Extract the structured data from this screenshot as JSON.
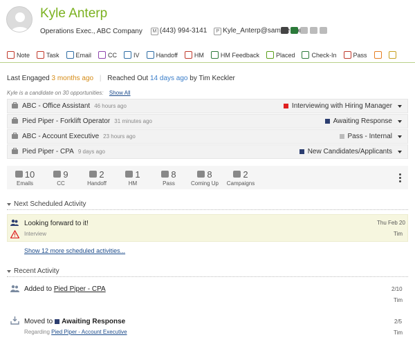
{
  "header": {
    "name": "Kyle Anterp",
    "title": "Operations Exec.",
    "company": "ABC Company",
    "phone_badge": "M",
    "phone": "(443) 994-3141",
    "email_badge": "P",
    "email": "Kyle_Anterp@sample.com",
    "social_icons": [
      "email-icon",
      "phone-icon",
      "facebook-icon",
      "linkedin-icon",
      "twitter-icon"
    ]
  },
  "toolbar": {
    "items": [
      {
        "label": "Note",
        "icon": "note-icon",
        "color": "#c0392b"
      },
      {
        "label": "Task",
        "icon": "task-icon",
        "color": "#c0392b"
      },
      {
        "label": "Email",
        "icon": "email-icon",
        "color": "#2e6da4"
      },
      {
        "label": "CC",
        "icon": "phone-icon",
        "color": "#8e44ad"
      },
      {
        "label": "IV",
        "icon": "people-icon",
        "color": "#2e6da4"
      },
      {
        "label": "Handoff",
        "icon": "check-icon",
        "color": "#2e6da4"
      },
      {
        "label": "HM",
        "icon": "people-icon",
        "color": "#c0392b"
      },
      {
        "label": "HM Feedback",
        "icon": "arrows-icon",
        "color": "#2c7a3a"
      },
      {
        "label": "Placed",
        "icon": "thumbs-up-icon",
        "color": "#5a9e1a"
      },
      {
        "label": "Check-In",
        "icon": "calendar-check-icon",
        "color": "#2c7a3a"
      },
      {
        "label": "Pass",
        "icon": "thumbs-down-icon",
        "color": "#c0392b"
      },
      {
        "label": "",
        "icon": "phone-icon",
        "color": "#e67e22"
      },
      {
        "label": "",
        "icon": "clipboard-icon",
        "color": "#c8a020"
      }
    ]
  },
  "engagement": {
    "last_engaged_label": "Last Engaged",
    "last_engaged_value": "3 months ago",
    "reached_out_label": "Reached Out",
    "reached_out_value": "14 days ago",
    "reached_out_by": "by Tim Keckler"
  },
  "candidate_note": {
    "text": "Kyle is a candidate on 30 opportunities:",
    "link": "Show All"
  },
  "opportunities": [
    {
      "title": "ABC - Office Assistant",
      "ago": "46 hours ago",
      "status": "Interviewing with Hiring Manager",
      "status_color": "#e02020"
    },
    {
      "title": "Pied Piper - Forklift Operator",
      "ago": "31 minutes ago",
      "status": "Awaiting Response",
      "status_color": "#2c3e70"
    },
    {
      "title": "ABC - Account Executive",
      "ago": "23 hours ago",
      "status": "Pass - Internal",
      "status_color": "#bbbbbb"
    },
    {
      "title": "Pied Piper - CPA",
      "ago": "9 days ago",
      "status": "New Candidates/Applicants",
      "status_color": "#2c3e70"
    }
  ],
  "stats": [
    {
      "count": "10",
      "label": "Emails",
      "icon": "email-icon"
    },
    {
      "count": "9",
      "label": "CC",
      "icon": "phone-icon"
    },
    {
      "count": "2",
      "label": "Handoff",
      "icon": "check-icon"
    },
    {
      "count": "1",
      "label": "HM",
      "icon": "people-icon"
    },
    {
      "count": "8",
      "label": "Pass",
      "icon": "thumbs-down-icon"
    },
    {
      "count": "8",
      "label": "Coming Up",
      "icon": "calendar-icon"
    },
    {
      "count": "2",
      "label": "Campaigns",
      "icon": "megaphone-icon"
    }
  ],
  "scheduled": {
    "heading": "Next Scheduled Activity",
    "title": "Looking forward to it!",
    "type": "Interview",
    "date": "Thu Feb 20",
    "by": "Tim",
    "show_more": "Show 12 more scheduled activities..."
  },
  "recent": {
    "heading": "Recent Activity",
    "items": [
      {
        "prefix": "Added to",
        "link": "Pied Piper - CPA",
        "sub_prefix": "",
        "sub_link": "",
        "date": "2/10",
        "by": "Tim"
      },
      {
        "prefix": "Moved to",
        "status": "Awaiting Response",
        "status_color": "#2c3e70",
        "sub_prefix": "Regarding",
        "sub_link": "Pied Piper - Account Executive",
        "date": "2/5",
        "by": "Tim"
      }
    ]
  }
}
